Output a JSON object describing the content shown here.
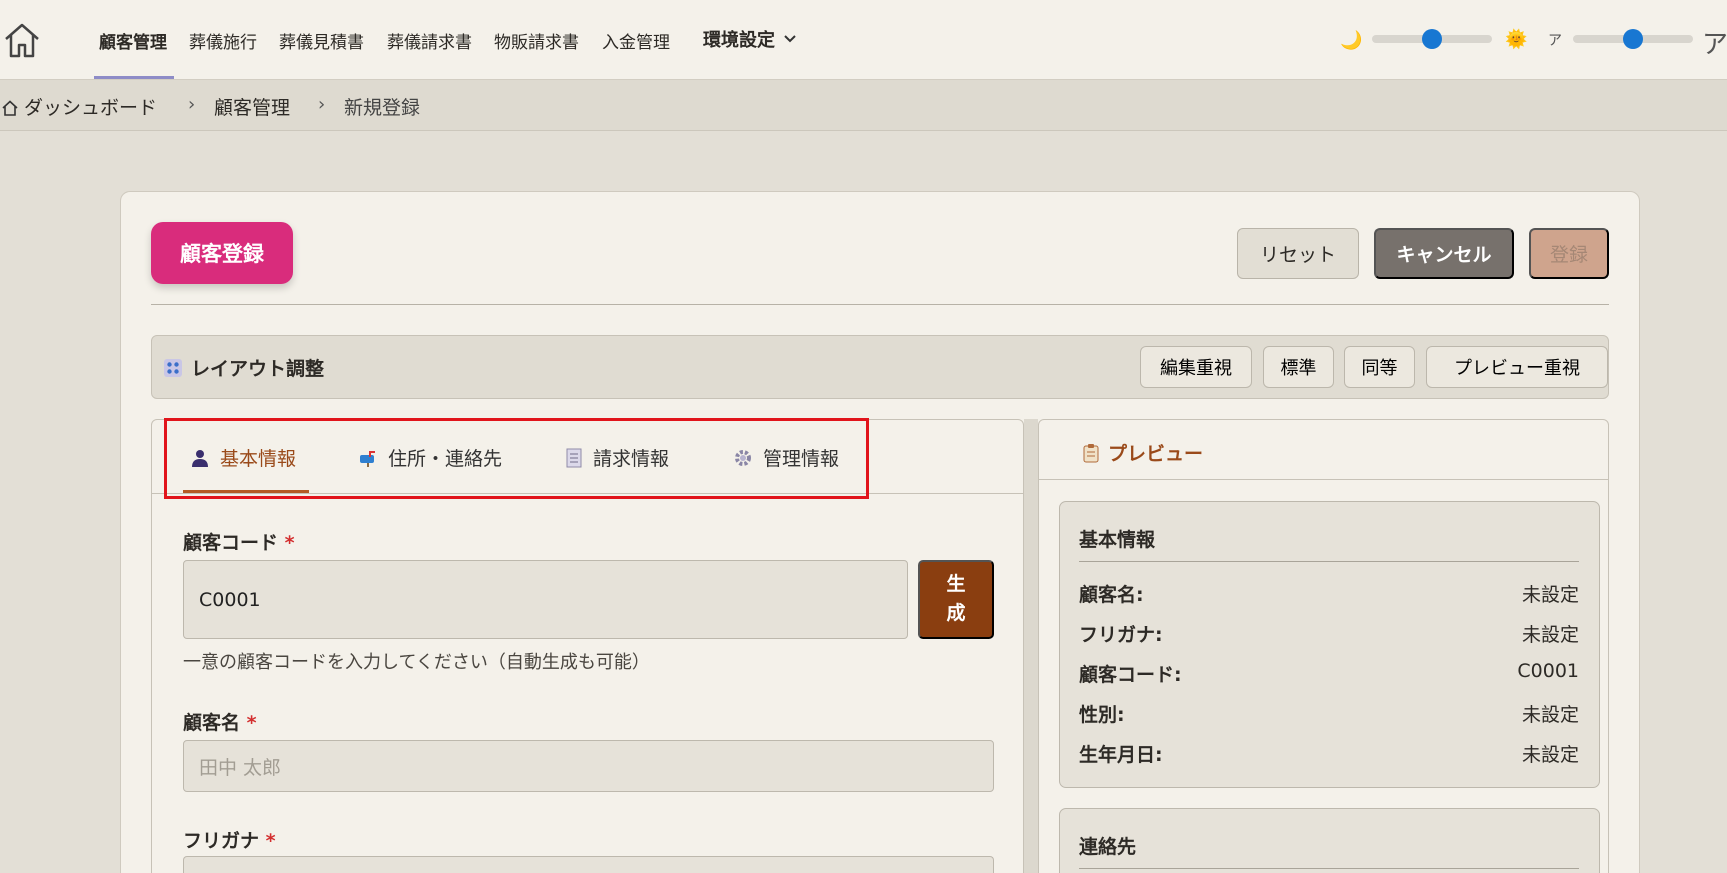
{
  "nav": {
    "items": [
      "顧客管理",
      "葬儀施行",
      "葬儀見積書",
      "葬儀請求書",
      "物販請求書",
      "入金管理"
    ],
    "settings_label": "環境設定",
    "font_small_label": "ア",
    "font_large_label": "ア",
    "theme_slider_value": 0.5,
    "font_slider_value": 0.5
  },
  "breadcrumb": {
    "items": [
      "ダッシュボード",
      "顧客管理",
      "新規登録"
    ]
  },
  "page": {
    "title": "顧客登録",
    "reset_label": "リセット",
    "cancel_label": "キャンセル",
    "submit_label": "登録"
  },
  "layout": {
    "title": "レイアウト調整",
    "options": [
      "編集重視",
      "標準",
      "同等",
      "プレビュー重視"
    ]
  },
  "tabs": [
    {
      "label": "基本情報",
      "icon": "person-icon",
      "active": true
    },
    {
      "label": "住所・連絡先",
      "icon": "mailbox-icon",
      "active": false
    },
    {
      "label": "請求情報",
      "icon": "receipt-icon",
      "active": false
    },
    {
      "label": "管理情報",
      "icon": "gear-icon",
      "active": false
    }
  ],
  "form": {
    "customer_code": {
      "label": "顧客コード",
      "required_mark": "*",
      "value": "C0001",
      "generate_label": "生成",
      "help": "一意の顧客コードを入力してください（自動生成も可能）"
    },
    "customer_name": {
      "label": "顧客名",
      "required_mark": "*",
      "placeholder": "田中 太郎"
    },
    "furigana": {
      "label": "フリガナ",
      "required_mark": "*"
    }
  },
  "preview": {
    "title": "プレビュー",
    "basic": {
      "title": "基本情報",
      "rows": [
        {
          "label": "顧客名:",
          "value": "未設定"
        },
        {
          "label": "フリガナ:",
          "value": "未設定"
        },
        {
          "label": "顧客コード:",
          "value": "C0001"
        },
        {
          "label": "性別:",
          "value": "未設定"
        },
        {
          "label": "生年月日:",
          "value": "未設定"
        }
      ]
    },
    "contact": {
      "title": "連絡先"
    }
  },
  "colors": {
    "accent": "#d92c7c",
    "brand_brown": "#8a3e10",
    "active_tab": "#b45a24",
    "highlight": "#e1141b",
    "slider": "#1877d2"
  }
}
